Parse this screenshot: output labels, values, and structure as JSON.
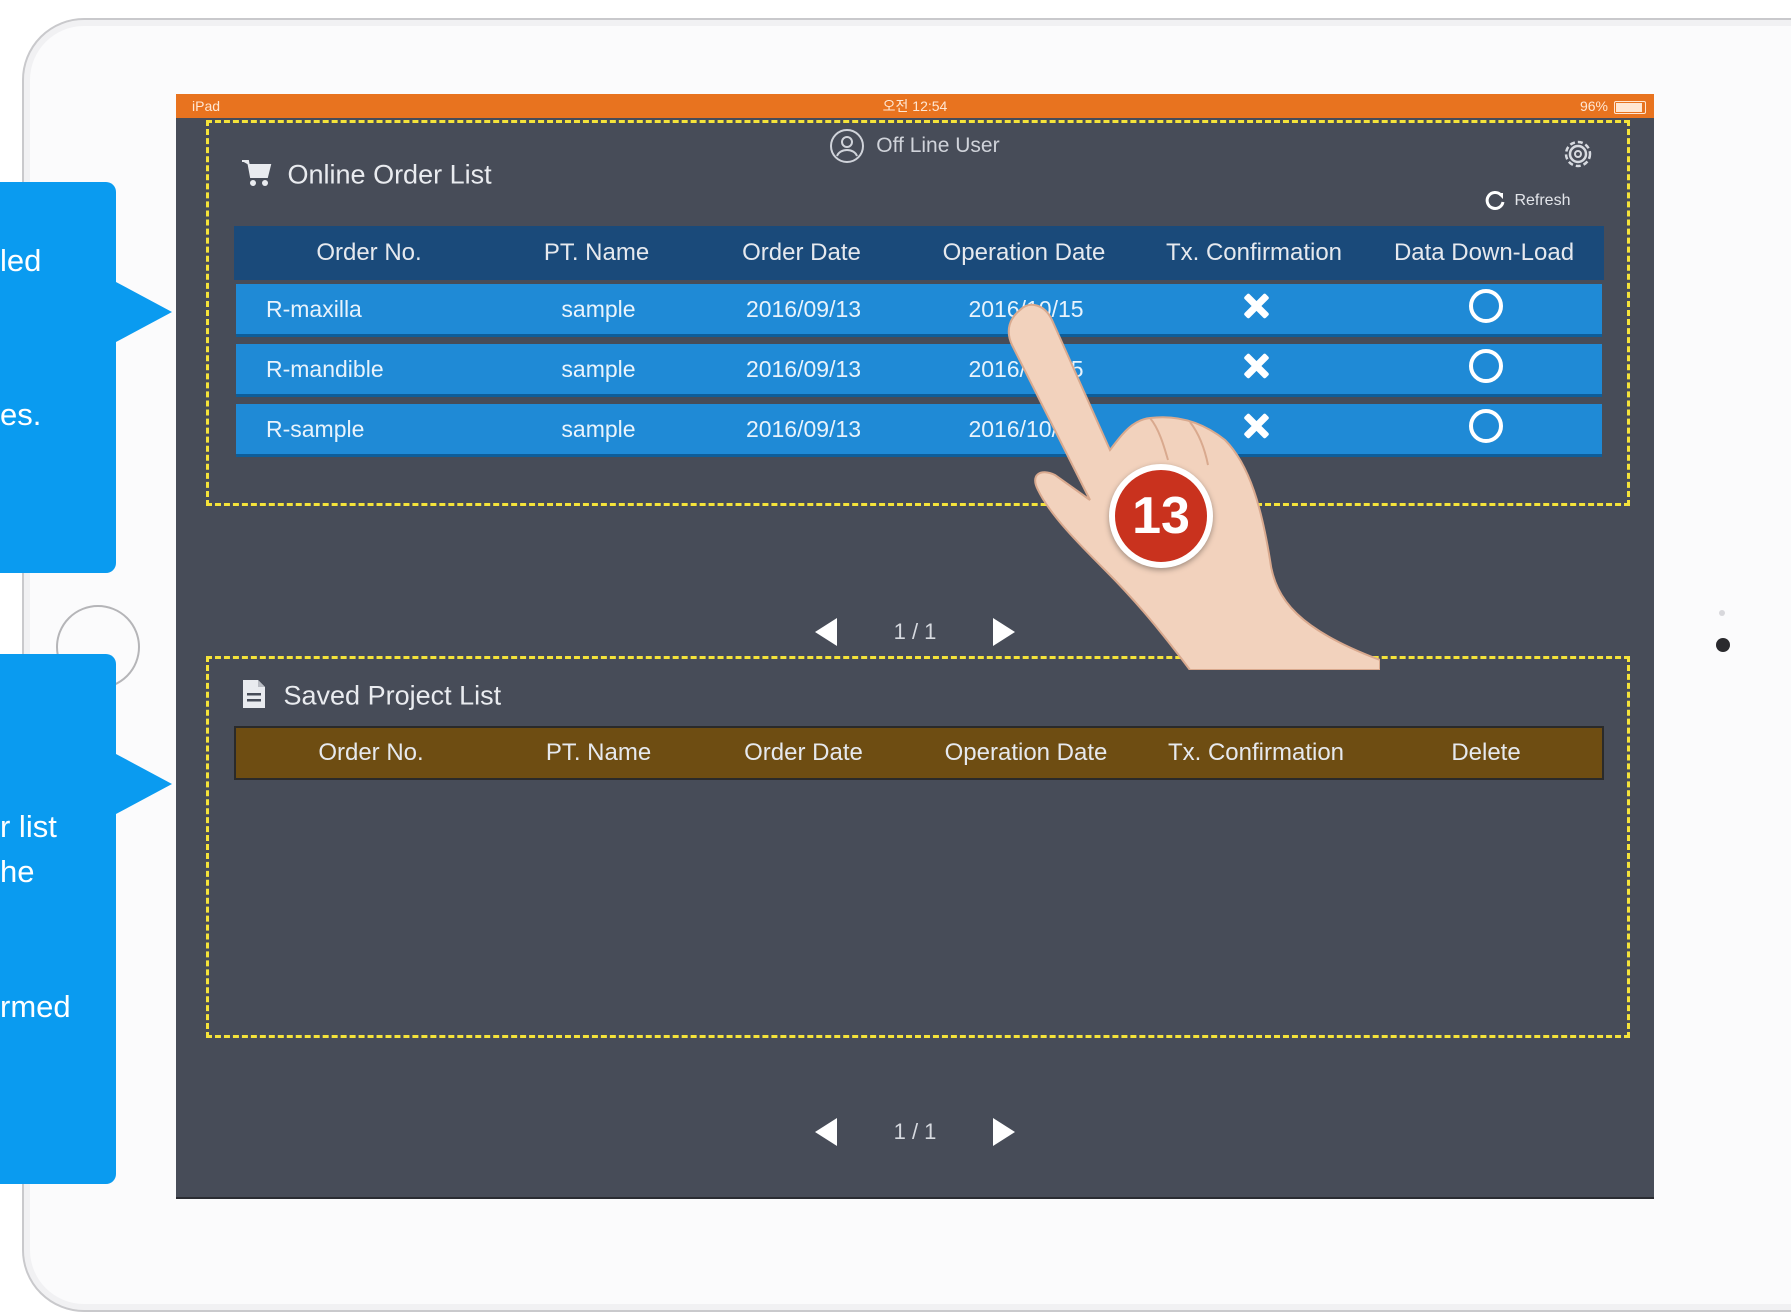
{
  "callouts": [
    {
      "lines": [
        "led",
        "es."
      ]
    },
    {
      "lines": [
        "r list",
        "he",
        "rmed"
      ]
    }
  ],
  "status_bar": {
    "left": "iPad",
    "center": "오전 12:54",
    "right": "96%"
  },
  "user": {
    "label": "Off Line User"
  },
  "online": {
    "title": "Online Order List",
    "refresh_label": "Refresh",
    "columns": [
      "Order No.",
      "PT. Name",
      "Order Date",
      "Operation Date",
      "Tx. Confirmation",
      "Data Down-Load"
    ],
    "rows": [
      {
        "order_no": "R-maxilla",
        "pt_name": "sample",
        "order_date": "2016/09/13",
        "operation_date": "2016/10/15",
        "tx": "x",
        "download": "o"
      },
      {
        "order_no": "R-mandible",
        "pt_name": "sample",
        "order_date": "2016/09/13",
        "operation_date": "2016/10/15",
        "tx": "x",
        "download": "o"
      },
      {
        "order_no": "R-sample",
        "pt_name": "sample",
        "order_date": "2016/09/13",
        "operation_date": "2016/10/15",
        "tx": "x",
        "download": "o"
      }
    ],
    "pager": "1 / 1"
  },
  "saved": {
    "title": "Saved Project List",
    "columns": [
      "Order No.",
      "PT. Name",
      "Order Date",
      "Operation Date",
      "Tx. Confirmation",
      "Delete"
    ],
    "pager": "1 / 1"
  },
  "step_badge": "13",
  "colors": {
    "statusbar": "#e8731f",
    "screen_bg": "#474c58",
    "online_header": "#1a4a7a",
    "row": "#1f8ad6",
    "saved_header": "#6e4d12",
    "callout": "#0a9bf0",
    "dash": "#f5e33a",
    "badge": "#c9321e"
  }
}
